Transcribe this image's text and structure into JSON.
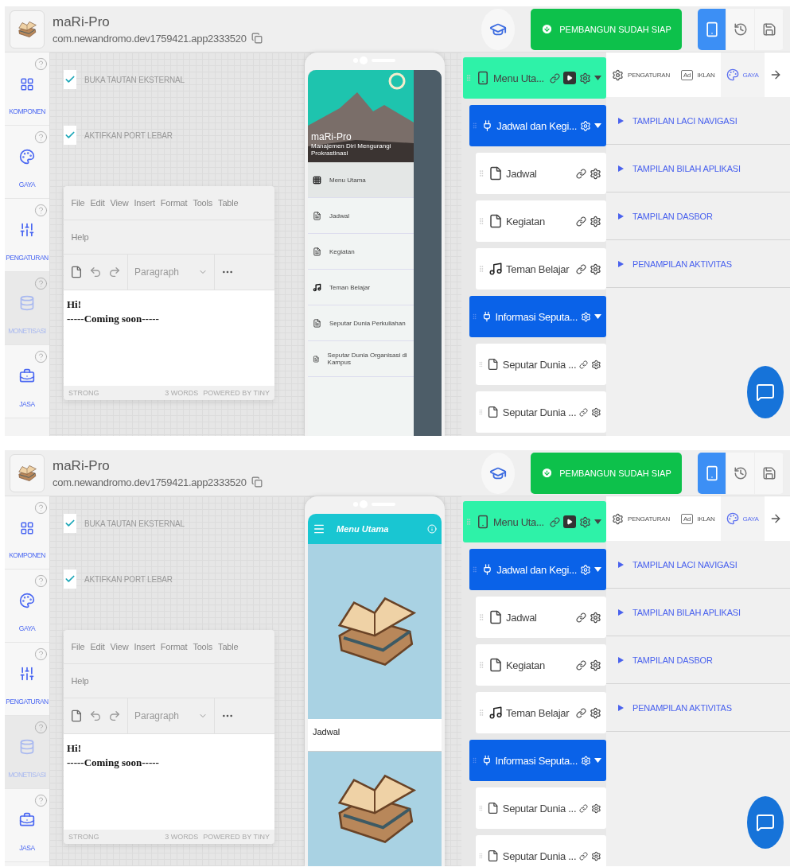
{
  "screens": [
    {
      "app": {
        "name": "maRi-Pro",
        "package": "com.newandromo.dev1759421.app2333520"
      },
      "build_button": "PEMBANGUN SUDAH SIAP",
      "device_buttons": [
        {
          "kind": "phone",
          "selected": true
        },
        {
          "kind": "history",
          "selected": false
        },
        {
          "kind": "save",
          "selected": false
        }
      ],
      "sidebar": [
        {
          "kind": "components",
          "label": "KOMPONEN",
          "disabled": false
        },
        {
          "kind": "style",
          "label": "GAYA",
          "disabled": false
        },
        {
          "kind": "settings",
          "label": "PENGATURAN",
          "disabled": false
        },
        {
          "kind": "money",
          "label": "MONETISASI",
          "disabled": true
        },
        {
          "kind": "services",
          "label": "JASA",
          "disabled": false
        }
      ],
      "options": [
        {
          "label": "BUKA TAUTAN EKSTERNAL",
          "checked": true
        },
        {
          "label": "AKTIFKAN PORT LEBAR",
          "checked": true
        }
      ],
      "editor": {
        "menu": [
          "File",
          "Edit",
          "View",
          "Insert",
          "Format",
          "Tools",
          "Table",
          "Help"
        ],
        "block_format": "Paragraph",
        "content": [
          "Hi!",
          "-----Coming soon-----"
        ],
        "path": "STRONG",
        "word_count": "3 WORDS",
        "branding": "POWERED BY TINY"
      },
      "preview": {
        "kind": "drawer",
        "title": "maRi-Pro",
        "subtitle": "Manajemen Diri Mengurangi Prokrastinasi",
        "items": [
          {
            "kind": "grid",
            "label": "Menu Utama",
            "selected": true
          },
          {
            "kind": "page",
            "label": "Jadwal",
            "selected": false
          },
          {
            "kind": "page",
            "label": "Kegiatan",
            "selected": false
          },
          {
            "kind": "music",
            "label": "Teman Belajar",
            "selected": false
          },
          {
            "kind": "page",
            "label": "Seputar Dunia Perkuliahan",
            "selected": false
          },
          {
            "kind": "page",
            "label": "Seputar Dunia Organisasi di Kampus",
            "selected": false
          }
        ]
      },
      "tree": [
        {
          "kind": "screen",
          "label": "Menu Uta...",
          "expanded": true,
          "children": [
            {
              "kind": "group",
              "label": "Jadwal dan Kegi...",
              "expanded": true,
              "children": [
                {
                  "kind": "page",
                  "label": "Jadwal"
                },
                {
                  "kind": "page",
                  "label": "Kegiatan"
                },
                {
                  "kind": "music",
                  "label": "Teman Belajar"
                }
              ]
            },
            {
              "kind": "group",
              "label": "Informasi Seputa...",
              "expanded": true,
              "children": [
                {
                  "kind": "page",
                  "label": "Seputar Dunia ..."
                },
                {
                  "kind": "page",
                  "label": "Seputar Dunia ..."
                }
              ]
            }
          ]
        }
      ],
      "panel": {
        "tabs": [
          {
            "kind": "settings",
            "label": "PENGATURAN",
            "selected": false
          },
          {
            "kind": "ads",
            "badge": "Ad",
            "label": "IKLAN",
            "selected": false
          },
          {
            "kind": "style",
            "label": "GAYA",
            "selected": true
          }
        ],
        "sections": [
          "TAMPILAN LACI NAVIGASI",
          "TAMPILAN BILAH APLIKASI",
          "TAMPILAN DASBOR",
          "PENAMPILAN AKTIVITAS"
        ]
      }
    },
    {
      "app": {
        "name": "maRi-Pro",
        "package": "com.newandromo.dev1759421.app2333520"
      },
      "build_button": "PEMBANGUN SUDAH SIAP",
      "device_buttons": [
        {
          "kind": "phone",
          "selected": true
        },
        {
          "kind": "history",
          "selected": false
        },
        {
          "kind": "save",
          "selected": false
        }
      ],
      "sidebar": [
        {
          "kind": "components",
          "label": "KOMPONEN",
          "disabled": false
        },
        {
          "kind": "style",
          "label": "GAYA",
          "disabled": false
        },
        {
          "kind": "settings",
          "label": "PENGATURAN",
          "disabled": false
        },
        {
          "kind": "money",
          "label": "MONETISASI",
          "disabled": true
        },
        {
          "kind": "services",
          "label": "JASA",
          "disabled": false
        }
      ],
      "options": [
        {
          "label": "BUKA TAUTAN EKSTERNAL",
          "checked": true
        },
        {
          "label": "AKTIFKAN PORT LEBAR",
          "checked": true
        }
      ],
      "editor": {
        "menu": [
          "File",
          "Edit",
          "View",
          "Insert",
          "Format",
          "Tools",
          "Table",
          "Help"
        ],
        "block_format": "Paragraph",
        "content": [
          "Hi!",
          "-----Coming soon-----"
        ],
        "path": "STRONG",
        "word_count": "3 WORDS",
        "branding": "POWERED BY TINY"
      },
      "preview": {
        "kind": "home",
        "title": "Menu Utama",
        "cards": [
          {
            "label": "Jadwal"
          }
        ]
      },
      "tree": [
        {
          "kind": "screen",
          "label": "Menu Uta...",
          "expanded": true,
          "children": [
            {
              "kind": "group",
              "label": "Jadwal dan Kegi...",
              "expanded": true,
              "children": [
                {
                  "kind": "page",
                  "label": "Jadwal"
                },
                {
                  "kind": "page",
                  "label": "Kegiatan"
                },
                {
                  "kind": "music",
                  "label": "Teman Belajar"
                }
              ]
            },
            {
              "kind": "group",
              "label": "Informasi Seputa...",
              "expanded": true,
              "children": [
                {
                  "kind": "page",
                  "label": "Seputar Dunia ..."
                },
                {
                  "kind": "page",
                  "label": "Seputar Dunia ..."
                }
              ]
            }
          ]
        }
      ],
      "panel": {
        "tabs": [
          {
            "kind": "settings",
            "label": "PENGATURAN",
            "selected": false
          },
          {
            "kind": "ads",
            "badge": "Ad",
            "label": "IKLAN",
            "selected": false
          },
          {
            "kind": "style",
            "label": "GAYA",
            "selected": true
          }
        ],
        "sections": [
          "TAMPILAN LACI NAVIGASI",
          "TAMPILAN BILAH APLIKASI",
          "TAMPILAN DASBOR",
          "PENAMPILAN AKTIVITAS"
        ]
      }
    }
  ]
}
